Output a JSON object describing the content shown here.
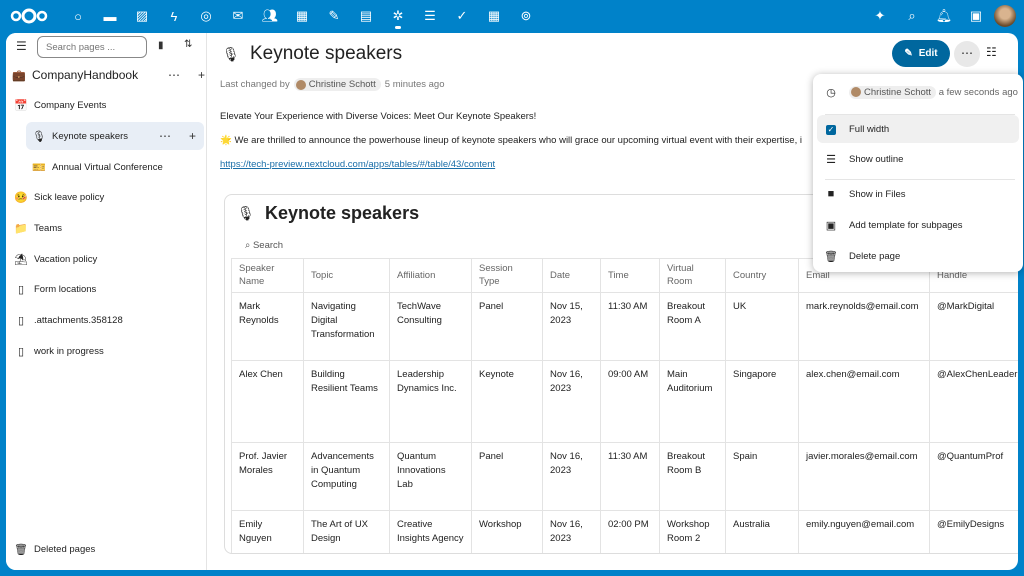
{
  "topbar": {
    "apps": [
      "dashboard-icon",
      "files-icon",
      "photos-icon",
      "activity-icon",
      "talk-icon",
      "mail-icon",
      "contacts-icon",
      "calendar-icon",
      "notes-icon",
      "deck-icon",
      "collectives-icon",
      "tasks-icon",
      "checkmark-icon",
      "tables-icon",
      "link-icon"
    ],
    "active_index": 10,
    "right": [
      "assistant-icon",
      "search-icon",
      "notifications-icon",
      "contacts-menu-icon"
    ]
  },
  "sidebar": {
    "search_placeholder": "Search pages ...",
    "collective": "CompanyHandbook",
    "items": [
      {
        "label": "Company Events",
        "icon": "📅"
      },
      {
        "label": "Keynote speakers",
        "icon": "🎙"
      },
      {
        "label": "Annual Virtual Conference",
        "icon": "🎫"
      },
      {
        "label": "Sick leave policy",
        "icon": "🤒"
      },
      {
        "label": "Teams",
        "icon": "📁"
      },
      {
        "label": "Vacation policy",
        "icon": "⛱"
      },
      {
        "label": "Form locations",
        "icon": "▯"
      },
      {
        "label": ".attachments.358128",
        "icon": "▯"
      },
      {
        "label": "work in progress",
        "icon": "▯"
      }
    ],
    "deleted": "Deleted pages"
  },
  "page": {
    "title": "Keynote speakers",
    "changed_prefix": "Last changed by",
    "author": "Christine Schott",
    "changed_time": "5 minutes ago",
    "edit_label": "Edit",
    "intro": "Elevate Your Experience with Diverse Voices: Meet Our Keynote Speakers!",
    "para": "🌟 We are thrilled to announce the powerhouse lineup of keynote speakers who will grace our upcoming virtual event with their expertise, i",
    "link": "https://tech-preview.nextcloud.com/apps/tables/#/table/43/content"
  },
  "table": {
    "title": "Keynote speakers",
    "search": "Search",
    "columns": [
      "Speaker Name",
      "Topic",
      "Affiliation",
      "Session Type",
      "Date",
      "Time",
      "Virtual Room",
      "Country",
      "Email",
      "Handle"
    ],
    "rows": [
      [
        "Mark Reynolds",
        "Navigating Digital Transformation",
        "TechWave Consulting",
        "Panel",
        "Nov 15, 2023",
        "11:30 AM",
        "Breakout Room A",
        "UK",
        "mark.reynolds@email.com",
        "@MarkDigital"
      ],
      [
        "Alex Chen",
        "Building Resilient Teams",
        "Leadership Dynamics Inc.",
        "Keynote",
        "Nov 16, 2023",
        "09:00 AM",
        "Main Auditorium",
        "Singapore",
        "alex.chen@email.com",
        "@AlexChenLeader"
      ],
      [
        "Prof. Javier Morales",
        "Advancements in Quantum Computing",
        "Quantum Innovations Lab",
        "Panel",
        "Nov 16, 2023",
        "11:30 AM",
        "Breakout Room B",
        "Spain",
        "javier.morales@email.com",
        "@QuantumProf"
      ],
      [
        "Emily Nguyen",
        "The Art of UX Design",
        "Creative Insights Agency",
        "Workshop",
        "Nov 16, 2023",
        "02:00 PM",
        "Workshop Room 2",
        "Australia",
        "emily.nguyen@email.com",
        "@EmilyDesigns"
      ]
    ]
  },
  "menu": {
    "author": "Christine Schott",
    "time": "a few seconds ago",
    "items": [
      "Full width",
      "Show outline",
      "Show in Files",
      "Add template for subpages",
      "Delete page"
    ],
    "full_width_checked": true
  },
  "colors": {
    "brand": "#0082c9",
    "primary": "#00679e"
  }
}
